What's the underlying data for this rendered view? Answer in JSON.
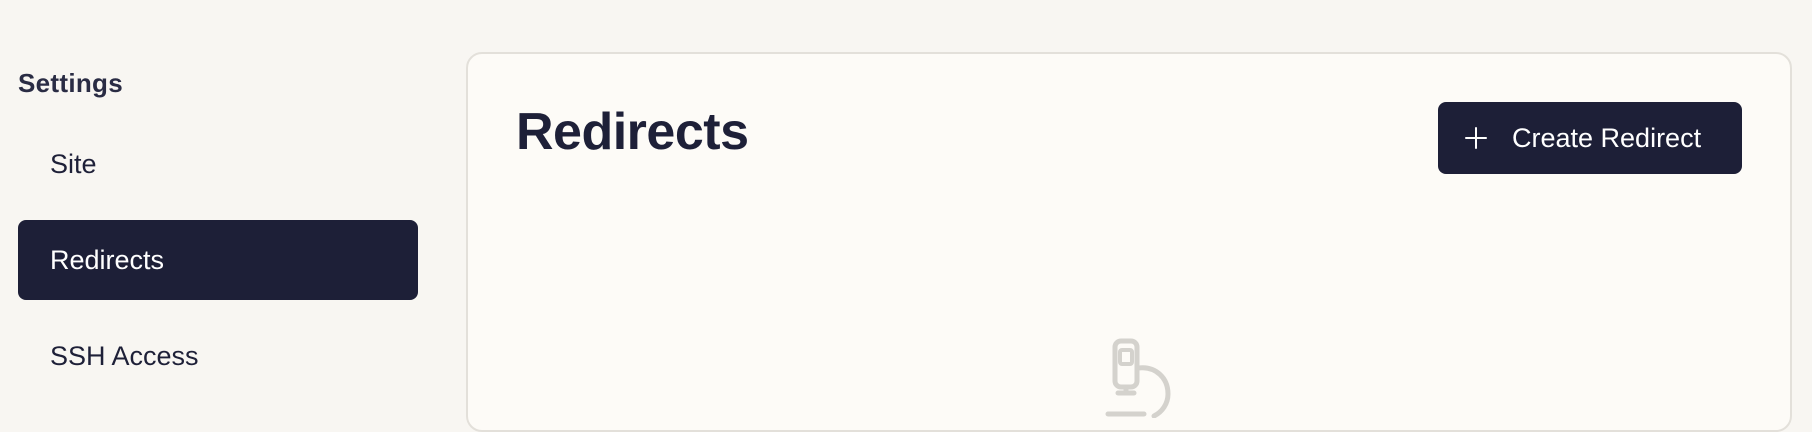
{
  "sidebar": {
    "heading": "Settings",
    "items": [
      {
        "label": "Site",
        "active": false
      },
      {
        "label": "Redirects",
        "active": true
      },
      {
        "label": "SSH Access",
        "active": false
      }
    ]
  },
  "main": {
    "title": "Redirects",
    "create_button_label": "Create Redirect",
    "create_button_icon": "plus-icon",
    "empty_state_icon": "microscope-icon"
  },
  "colors": {
    "background": "#f8f6f2",
    "panel": "#fdfbf7",
    "primary_dark": "#1d1f37",
    "text": "#1e2038",
    "icon_muted": "#d4d2cd"
  }
}
